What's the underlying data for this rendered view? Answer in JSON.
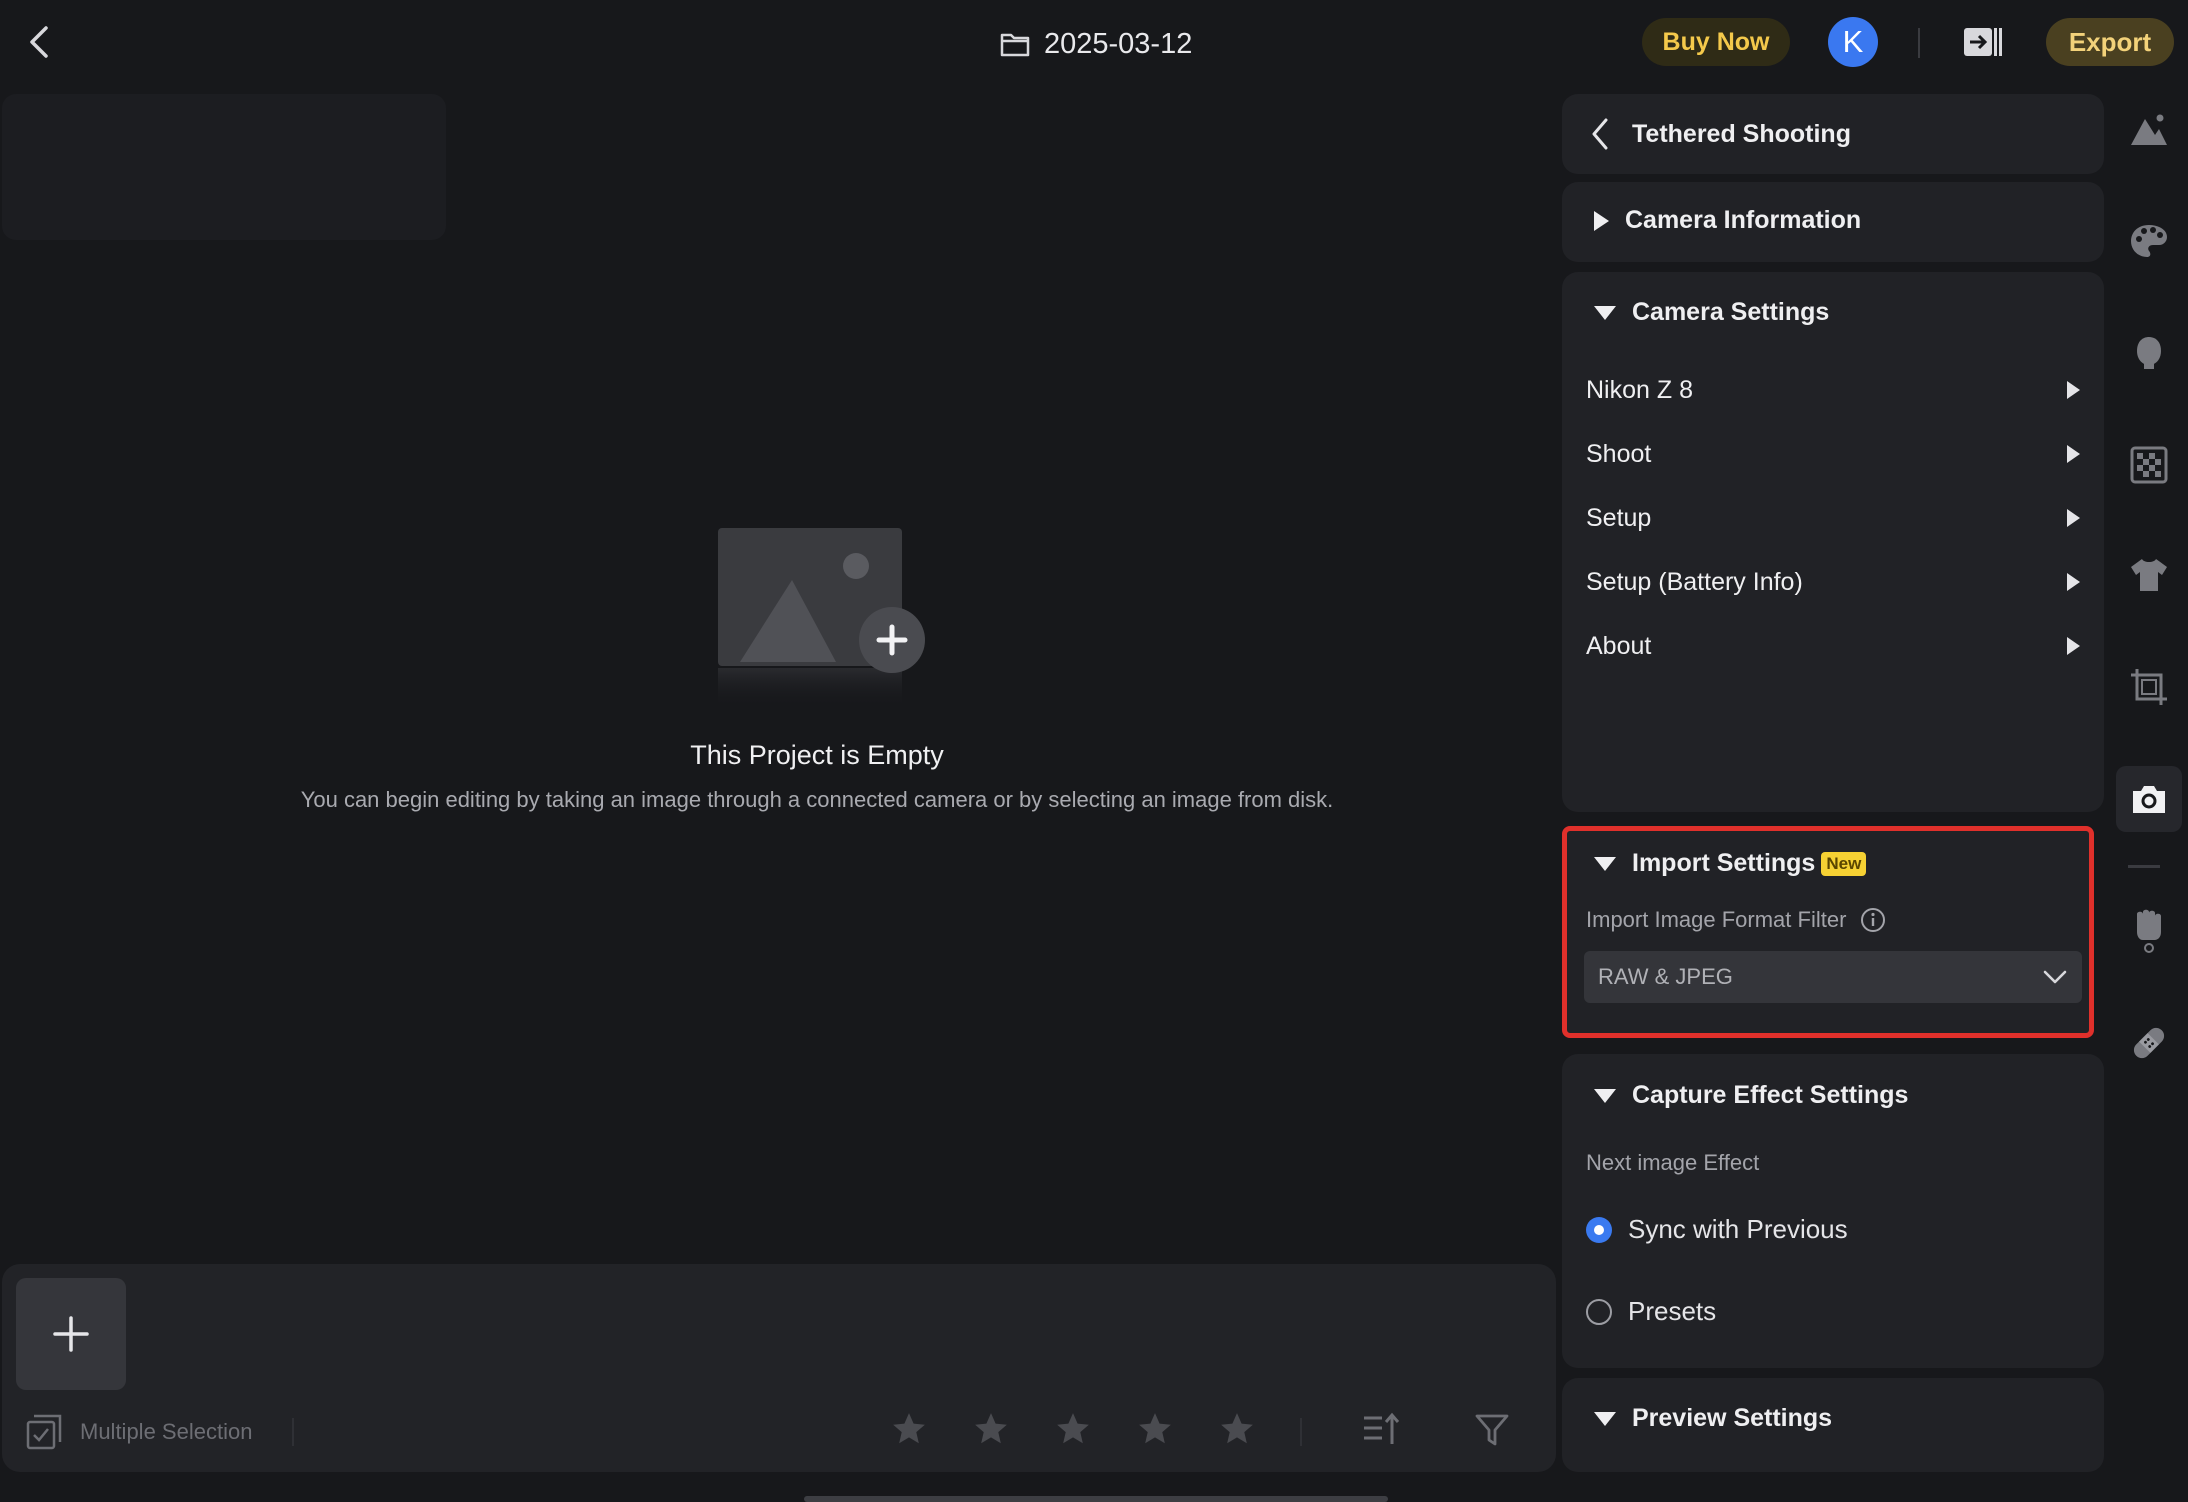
{
  "header": {
    "project_title": "2025-03-12",
    "buy_label": "Buy Now",
    "avatar_initial": "K",
    "export_label": "Export"
  },
  "empty_state": {
    "title": "This Project is Empty",
    "description": "You can begin editing by taking an image through a connected camera or by selecting an image from disk."
  },
  "bottom_bar": {
    "multiple_selection_label": "Multiple Selection",
    "rating_stars": 5
  },
  "panel": {
    "back_title": "Tethered Shooting",
    "camera_information": {
      "title": "Camera Information"
    },
    "camera_settings": {
      "title": "Camera Settings",
      "items": [
        {
          "label": "Nikon Z 8"
        },
        {
          "label": "Shoot"
        },
        {
          "label": "Setup"
        },
        {
          "label": "Setup (Battery Info)"
        },
        {
          "label": "About"
        }
      ]
    },
    "import_settings": {
      "title": "Import Settings",
      "badge": "New",
      "filter_label": "Import Image Format Filter",
      "filter_value": "RAW & JPEG"
    },
    "capture_effect": {
      "title": "Capture Effect Settings",
      "subtitle": "Next image Effect",
      "options": [
        {
          "label": "Sync with Previous",
          "selected": true
        },
        {
          "label": "Presets",
          "selected": false
        }
      ]
    },
    "preview_settings": {
      "title": "Preview Settings"
    }
  },
  "tool_rail": {
    "icons": [
      "landscape-icon",
      "palette-icon",
      "portrait-icon",
      "checker-icon",
      "shirt-icon",
      "crop-icon",
      "camera-icon",
      "hand-icon",
      "bandage-icon"
    ],
    "active": "camera-icon"
  },
  "colors": {
    "background": "#17181b",
    "panel": "#212226",
    "accent_blue": "#3a7af0",
    "buy_text": "#f4c94b",
    "highlight_red": "#e0302b",
    "badge_yellow": "#f6d133"
  }
}
